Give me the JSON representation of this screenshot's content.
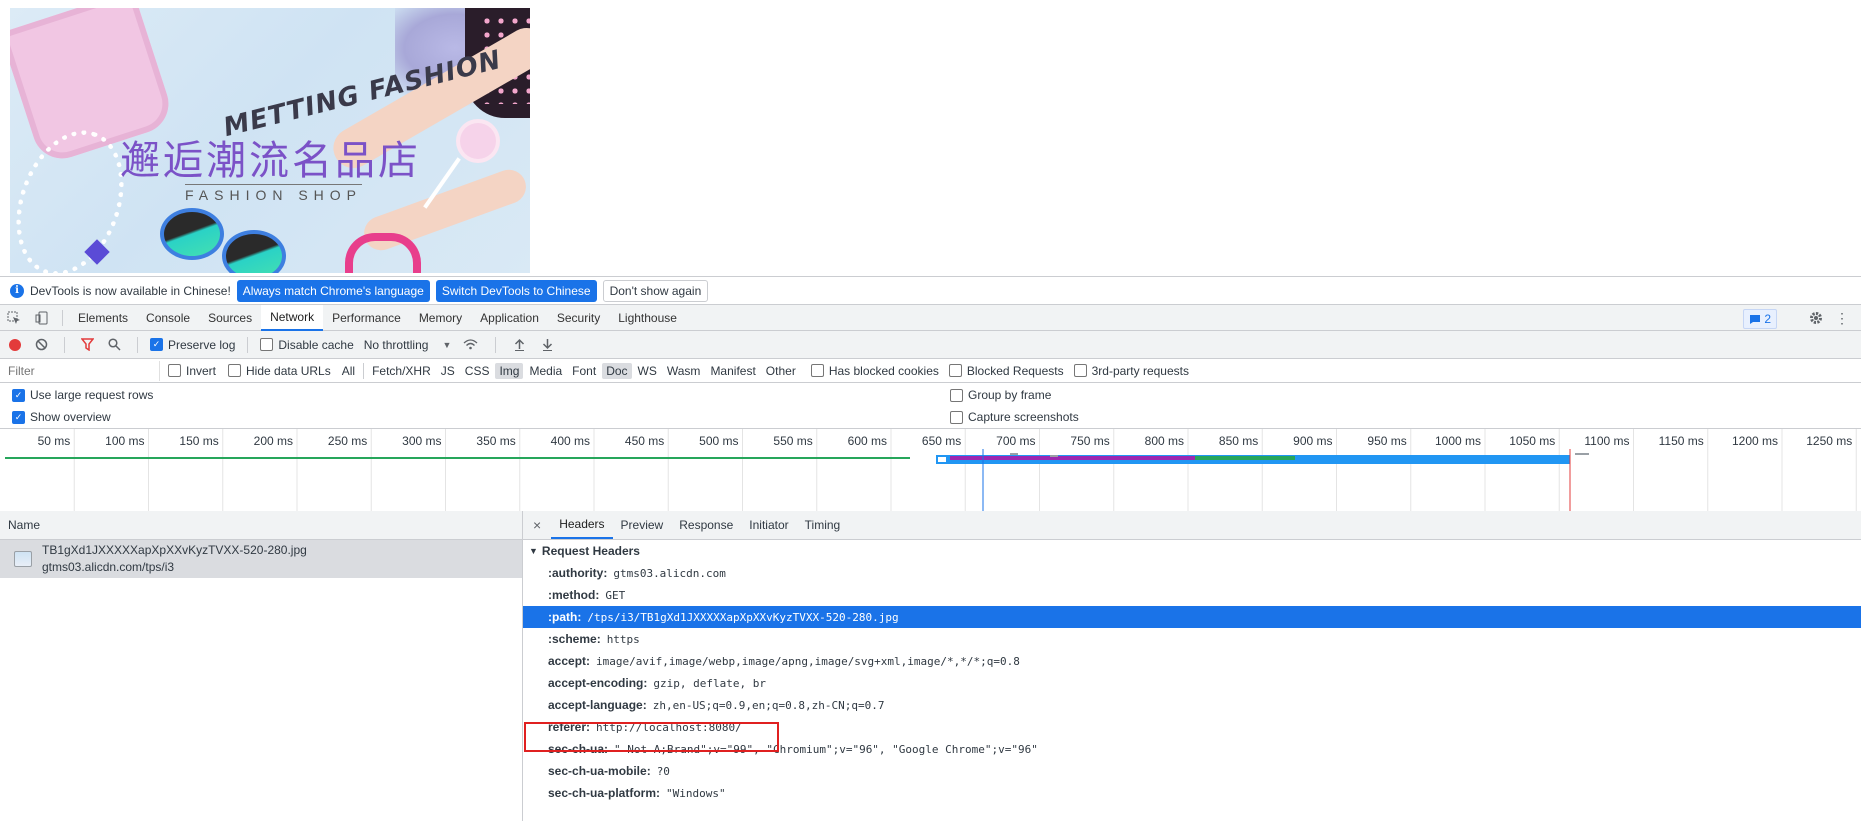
{
  "banner": {
    "title_en": "METTING FASHION",
    "title_cn": "邂逅潮流名品店",
    "subtitle": "FASHION SHOP"
  },
  "infobar": {
    "message": "DevTools is now available in Chinese!",
    "btn_match": "Always match Chrome's language",
    "btn_switch": "Switch DevTools to Chinese",
    "btn_dismiss": "Don't show again"
  },
  "tabs": [
    "Elements",
    "Console",
    "Sources",
    "Network",
    "Performance",
    "Memory",
    "Application",
    "Security",
    "Lighthouse"
  ],
  "active_tab": "Network",
  "issues_count": "2",
  "toolbar": {
    "preserve_log": "Preserve log",
    "disable_cache": "Disable cache",
    "throttling": "No throttling"
  },
  "filter": {
    "placeholder": "Filter",
    "invert": "Invert",
    "hide_data_urls": "Hide data URLs",
    "types": [
      "All",
      "Fetch/XHR",
      "JS",
      "CSS",
      "Img",
      "Media",
      "Font",
      "Doc",
      "WS",
      "Wasm",
      "Manifest",
      "Other"
    ],
    "has_blocked_cookies": "Has blocked cookies",
    "blocked_requests": "Blocked Requests",
    "third_party": "3rd-party requests"
  },
  "options": {
    "large_rows": "Use large request rows",
    "show_overview": "Show overview",
    "group_by_frame": "Group by frame",
    "capture_screenshots": "Capture screenshots"
  },
  "timeline_ticks": [
    "50 ms",
    "100 ms",
    "150 ms",
    "200 ms",
    "250 ms",
    "300 ms",
    "350 ms",
    "400 ms",
    "450 ms",
    "500 ms",
    "550 ms",
    "600 ms",
    "650 ms",
    "700 ms",
    "750 ms",
    "800 ms",
    "850 ms",
    "900 ms",
    "950 ms",
    "1000 ms",
    "1050 ms",
    "1100 ms",
    "1150 ms",
    "1200 ms",
    "1250 ms"
  ],
  "colors": {
    "accent": "#1a73e8",
    "record": "#e33b3b",
    "highlight_box": "#e02020",
    "bar_blue": "#2196f3",
    "bar_purple": "#9c27b0",
    "bar_green": "#26a65b"
  },
  "name_panel": {
    "header": "Name",
    "request": {
      "file": "TB1gXd1JXXXXXapXpXXvKyzTVXX-520-280.jpg",
      "host": "gtms03.alicdn.com/tps/i3"
    }
  },
  "detail_tabs": [
    "Headers",
    "Preview",
    "Response",
    "Initiator",
    "Timing"
  ],
  "active_detail_tab": "Headers",
  "request_headers": {
    "title": "Request Headers",
    "rows": [
      {
        "k": ":authority:",
        "v": "gtms03.alicdn.com"
      },
      {
        "k": ":method:",
        "v": "GET"
      },
      {
        "k": ":path:",
        "v": "/tps/i3/TB1gXd1JXXXXXapXpXXvKyzTVXX-520-280.jpg"
      },
      {
        "k": ":scheme:",
        "v": "https"
      },
      {
        "k": "accept:",
        "v": "image/avif,image/webp,image/apng,image/svg+xml,image/*,*/*;q=0.8"
      },
      {
        "k": "accept-encoding:",
        "v": "gzip, deflate, br"
      },
      {
        "k": "accept-language:",
        "v": "zh,en-US;q=0.9,en;q=0.8,zh-CN;q=0.7"
      },
      {
        "k": "referer:",
        "v": "http://localhost:8080/"
      },
      {
        "k": "sec-ch-ua:",
        "v": "\" Not A;Brand\";v=\"99\", \"Chromium\";v=\"96\", \"Google Chrome\";v=\"96\""
      },
      {
        "k": "sec-ch-ua-mobile:",
        "v": "?0"
      },
      {
        "k": "sec-ch-ua-platform:",
        "v": "\"Windows\""
      }
    ]
  }
}
